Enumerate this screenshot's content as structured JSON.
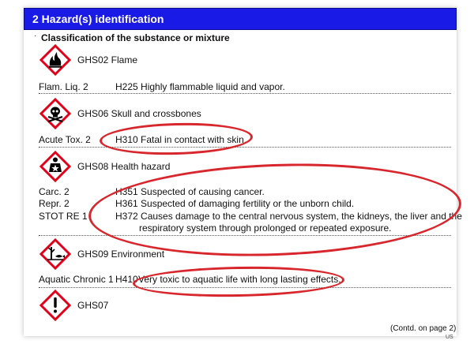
{
  "section": {
    "title": "2 Hazard(s) identification"
  },
  "subheading": {
    "bullet": "·",
    "text": "Classification of the substance or mixture"
  },
  "pictograms": [
    {
      "label": "GHS02 Flame",
      "icon": "flame-icon"
    },
    {
      "label": "GHS06 Skull and crossbones",
      "icon": "skull-crossbones-icon"
    },
    {
      "label": "GHS08 Health hazard",
      "icon": "health-hazard-icon"
    },
    {
      "label": "GHS09 Environment",
      "icon": "environment-icon"
    },
    {
      "label": "GHS07",
      "icon": "exclamation-mark-icon"
    }
  ],
  "hazards": {
    "flammable": {
      "class": "Flam. Liq. 2",
      "statement": "H225 Highly flammable liquid and vapor."
    },
    "acute_tox": {
      "class": "Acute Tox. 2",
      "statement": "H310 Fatal in contact with skin."
    },
    "carc": {
      "class": "Carc. 2",
      "statement": "H351 Suspected of causing cancer."
    },
    "repr": {
      "class": "Repr. 2",
      "statement": "H361 Suspected of damaging fertility or the unborn child."
    },
    "stot": {
      "class": "STOT RE 1",
      "statement_line1": "H372 Causes damage to the central nervous system, the kidneys, the liver and the",
      "statement_line2": "respiratory system through prolonged or repeated exposure."
    },
    "aquatic": {
      "class": "Aquatic Chronic 1",
      "code": "H410",
      "statement": "Very toxic to aquatic life with long lasting effects."
    }
  },
  "footer": {
    "continued": "(Contd. on page 2)",
    "tag": "US"
  },
  "colors": {
    "section_bar": "#1a1ae6",
    "pictogram_border": "#e0001a",
    "highlight_oval": "#d8262d"
  }
}
